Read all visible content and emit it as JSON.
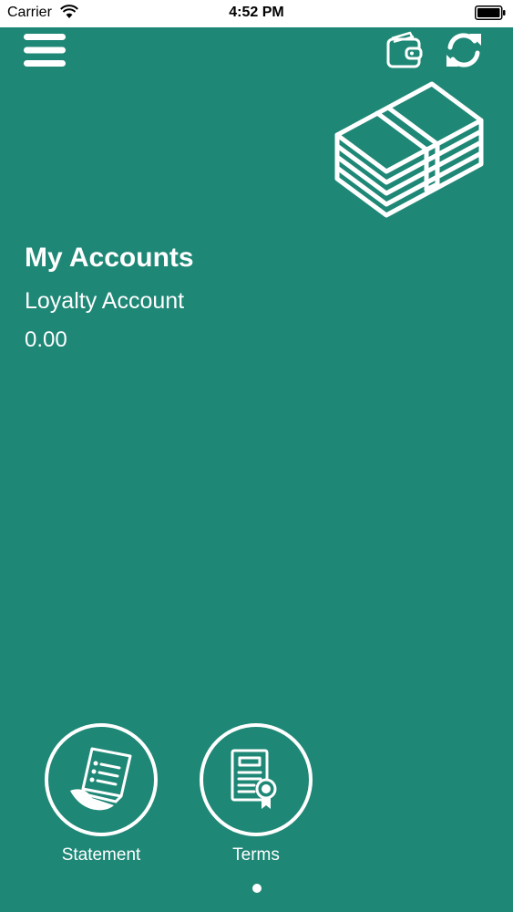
{
  "status_bar": {
    "carrier": "Carrier",
    "time": "4:52 PM"
  },
  "header": {
    "menu_icon": "hamburger-menu-icon",
    "wallet_icon": "wallet-icon",
    "refresh_icon": "refresh-icon"
  },
  "hero_icon": "money-stack-icon",
  "accounts": {
    "title": "My Accounts",
    "items": [
      {
        "name": "Loyalty Account",
        "balance": "0.00"
      }
    ]
  },
  "actions": [
    {
      "label": "Statement",
      "icon": "statement-receipt-icon"
    },
    {
      "label": "Terms",
      "icon": "terms-certificate-icon"
    }
  ],
  "pager": {
    "current": 1,
    "total": 1
  },
  "colors": {
    "background": "#1e8776",
    "foreground": "#ffffff",
    "status_bar_bg": "#ffffff"
  }
}
